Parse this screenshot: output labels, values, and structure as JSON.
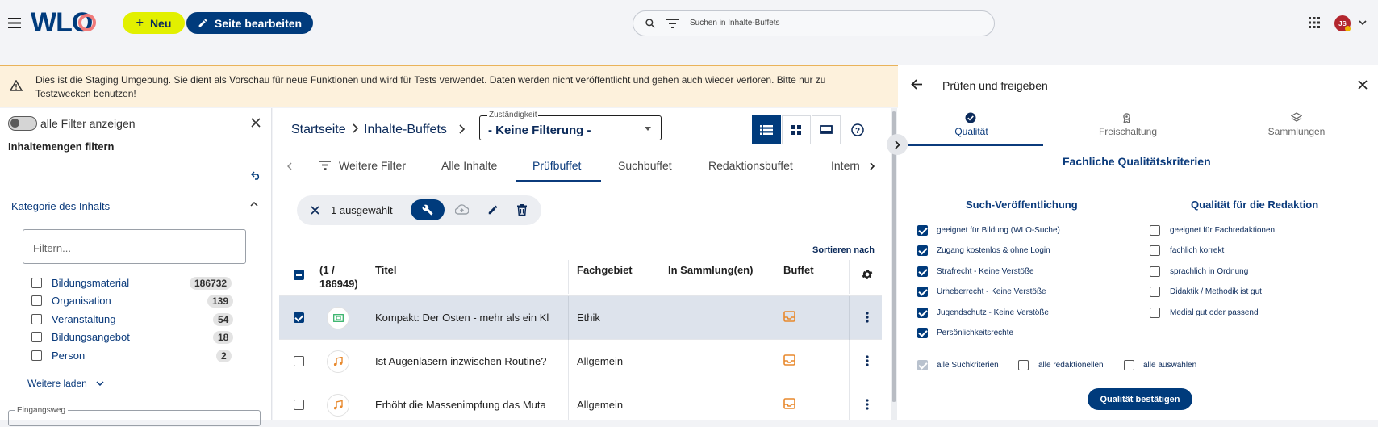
{
  "header": {
    "logo_text": "WLO",
    "new_label": "Neu",
    "edit_label": "Seite bearbeiten",
    "search_placeholder": "Suchen in Inhalte-Buffets",
    "avatar_initials": "JS"
  },
  "banner": {
    "text": "Dies ist die Staging Umgebung. Sie dient als Vorschau für neue Funktionen und wird für Tests verwendet. Daten werden nicht veröffentlicht und gehen auch wieder verloren. Bitte nur zu Testzwecken benutzen!"
  },
  "filter": {
    "toggle_label": "alle Filter anzeigen",
    "title": "Inhaltemengen filtern",
    "section_title": "Kategorie des Inhalts",
    "input_placeholder": "Filtern...",
    "items": [
      {
        "label": "Bildungsmaterial",
        "count": "186732"
      },
      {
        "label": "Organisation",
        "count": "139"
      },
      {
        "label": "Veranstaltung",
        "count": "54"
      },
      {
        "label": "Bildungsangebot",
        "count": "18"
      },
      {
        "label": "Person",
        "count": "2"
      }
    ],
    "more_label": "Weitere laden",
    "next_field_label": "Eingangsweg"
  },
  "main": {
    "breadcrumb": [
      "Startseite",
      "Inhalte-Buffets"
    ],
    "select_label": "Zuständigkeit",
    "select_value": "- Keine Filterung -",
    "tabs": [
      "Weitere Filter",
      "Alle Inhalte",
      "Prüfbuffet",
      "Suchbuffet",
      "Redaktionsbuffet",
      "Intern"
    ],
    "active_tab": "Prüfbuffet",
    "selection_label": "1 ausgewählt",
    "sort_label": "Sortieren nach",
    "columns": {
      "count": "(1 / 186949)",
      "title": "Titel",
      "subject": "Fachgebiet",
      "collections": "In Sammlung(en)",
      "buffet": "Buffet"
    },
    "rows": [
      {
        "title": "Kompakt: Der Osten - mehr als ein Kl",
        "subject": "Ethik",
        "selected": true
      },
      {
        "title": "Ist Augenlasern inzwischen Routine?",
        "subject": "Allgemein",
        "selected": false
      },
      {
        "title": "Erhöht die Massenimpfung das Muta",
        "subject": "Allgemein",
        "selected": false
      }
    ]
  },
  "panel": {
    "title": "Prüfen und freigeben",
    "tabs": [
      "Qualität",
      "Freischaltung",
      "Sammlungen"
    ],
    "section_title": "Fachliche Qualitätskriterien",
    "col1_title": "Such-Veröffentlichung",
    "col2_title": "Qualität für die Redaktion",
    "col1_items": [
      "geeignet für Bildung (WLO-Suche)",
      "Zugang kostenlos & ohne Login",
      "Strafrecht - Keine Verstöße",
      "Urheberrecht - Keine Verstöße",
      "Jugendschutz - Keine Verstöße",
      "Persönlichkeitsrechte"
    ],
    "col2_items": [
      "geeignet für Fachredaktionen",
      "fachlich korrekt",
      "sprachlich in Ordnung",
      "Didaktik / Methodik ist gut",
      "Medial gut oder passend"
    ],
    "all_search": "alle Suchkriterien",
    "all_editorial": "alle redaktionellen",
    "all_select": "alle auswählen",
    "confirm_label": "Qualität bestätigen"
  },
  "colors": {
    "primary": "#003b7c",
    "accent": "#e2f000",
    "buffet_orange": "#e8892d",
    "banner_bg": "#fdf1dc"
  }
}
